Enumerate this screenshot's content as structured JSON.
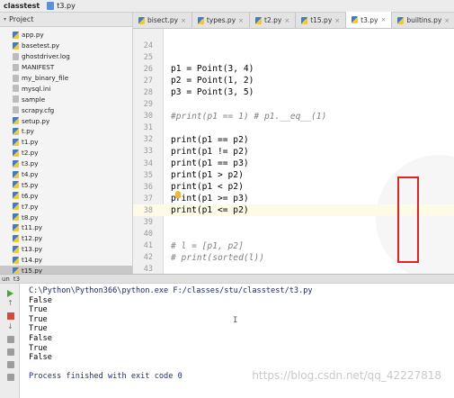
{
  "breadcrumb": {
    "project": "classtest",
    "file": "t3.py"
  },
  "project_panel": {
    "header": "Project",
    "items": [
      {
        "label": "app.py",
        "type": "py"
      },
      {
        "label": "basetest.py",
        "type": "py"
      },
      {
        "label": "ghostdriver.log",
        "type": "txt"
      },
      {
        "label": "MANIFEST",
        "type": "txt"
      },
      {
        "label": "my_binary_file",
        "type": "txt"
      },
      {
        "label": "mysql.ini",
        "type": "txt"
      },
      {
        "label": "sample",
        "type": "txt"
      },
      {
        "label": "scrapy.cfg",
        "type": "txt"
      },
      {
        "label": "setup.py",
        "type": "py"
      },
      {
        "label": "t.py",
        "type": "py"
      },
      {
        "label": "t1.py",
        "type": "py"
      },
      {
        "label": "t2.py",
        "type": "py"
      },
      {
        "label": "t3.py",
        "type": "py"
      },
      {
        "label": "t4.py",
        "type": "py"
      },
      {
        "label": "t5.py",
        "type": "py"
      },
      {
        "label": "t6.py",
        "type": "py"
      },
      {
        "label": "t7.py",
        "type": "py"
      },
      {
        "label": "t8.py",
        "type": "py"
      },
      {
        "label": "t11.py",
        "type": "py"
      },
      {
        "label": "t12.py",
        "type": "py"
      },
      {
        "label": "t13.py",
        "type": "py"
      },
      {
        "label": "t14.py",
        "type": "py"
      },
      {
        "label": "t15.py",
        "type": "py"
      }
    ]
  },
  "tabs": [
    {
      "label": "bisect.py"
    },
    {
      "label": "types.py"
    },
    {
      "label": "t2.py"
    },
    {
      "label": "t15.py"
    },
    {
      "label": "t3.py"
    },
    {
      "label": "builtins.py"
    }
  ],
  "editor": {
    "lines": [
      {
        "num": "24",
        "code": ""
      },
      {
        "num": "25",
        "code": ""
      },
      {
        "num": "26",
        "code": "p1 = Point(3, 4)"
      },
      {
        "num": "27",
        "code": "p2 = Point(1, 2)"
      },
      {
        "num": "28",
        "code": "p3 = Point(3, 5)"
      },
      {
        "num": "29",
        "code": ""
      },
      {
        "num": "30",
        "code": "#print(p1 == 1) # p1.__eq__(1)"
      },
      {
        "num": "31",
        "code": ""
      },
      {
        "num": "32",
        "code": "print(p1 == p2)"
      },
      {
        "num": "33",
        "code": "print(p1 != p2)"
      },
      {
        "num": "34",
        "code": "print(p1 == p3)"
      },
      {
        "num": "35",
        "code": "print(p1 > p2)"
      },
      {
        "num": "36",
        "code": "print(p1 < p2)"
      },
      {
        "num": "37",
        "code": "print(p1 >= p3)"
      },
      {
        "num": "38",
        "code": "print(p1 <= p2)"
      },
      {
        "num": "39",
        "code": ""
      },
      {
        "num": "40",
        "code": ""
      },
      {
        "num": "41",
        "code": "# l = [p1, p2]"
      },
      {
        "num": "42",
        "code": "# print(sorted(l))"
      },
      {
        "num": "43",
        "code": ""
      }
    ]
  },
  "run": {
    "tab_label": "un",
    "config": "t3",
    "output": [
      "C:\\Python\\Python366\\python.exe F:/classes/stu/classtest/t3.py",
      "False",
      "True",
      "True",
      "True",
      "False",
      "True",
      "False",
      "",
      "Process finished with exit code 0"
    ],
    "watermark": "https://blog.csdn.net/qq_42227818"
  }
}
